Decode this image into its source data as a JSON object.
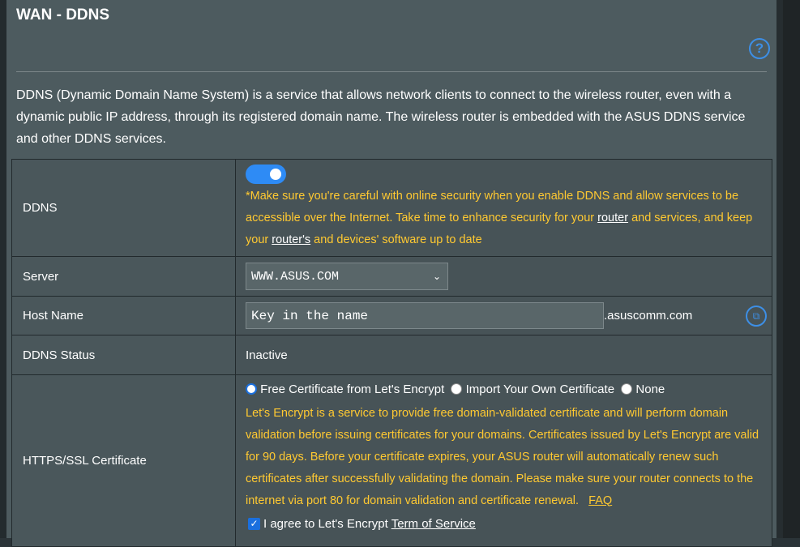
{
  "page": {
    "title": "WAN - DDNS",
    "description": "DDNS (Dynamic Domain Name System) is a service that allows network clients to connect to the wireless router, even with a dynamic public IP address, through its registered domain name. The wireless router is embedded with the ASUS DDNS service and other DDNS services."
  },
  "rows": {
    "ddns": {
      "label": "DDNS",
      "enabled": true,
      "warning_pre": "*Make sure you're careful with online security when you enable DDNS and allow services to be accessible over the Internet. Take time to enhance security for your ",
      "warning_link1": "router",
      "warning_mid": " and services, and keep your ",
      "warning_link2": "router's",
      "warning_post": " and devices' software up to date"
    },
    "server": {
      "label": "Server",
      "value": "WWW.ASUS.COM"
    },
    "hostname": {
      "label": "Host Name",
      "placeholder": "Key in the name",
      "suffix": ".asuscomm.com"
    },
    "status": {
      "label": "DDNS Status",
      "value": "Inactive"
    },
    "https": {
      "label": "HTTPS/SSL Certificate",
      "options": [
        "Free Certificate from Let's Encrypt",
        "Import Your Own Certificate",
        "None"
      ],
      "selected": "Free Certificate from Let's Encrypt",
      "info": "Let's Encrypt is a service to provide free domain-validated certificate and will perform domain validation before issuing certificates for your domains. Certificates issued by Let's Encrypt are valid for 90 days. Before your certificate expires, your ASUS router will automatically renew such certificates after successfully validating the domain. Please make sure your router connects to the internet via port 80 for domain validation and certificate renewal.",
      "faq": "FAQ",
      "agree_text": "I agree to Let's Encrypt",
      "agree_link": "Term of Service",
      "agree_checked": true
    }
  },
  "colors": {
    "accent": "#2e8bf5",
    "warning": "#ffc931"
  }
}
